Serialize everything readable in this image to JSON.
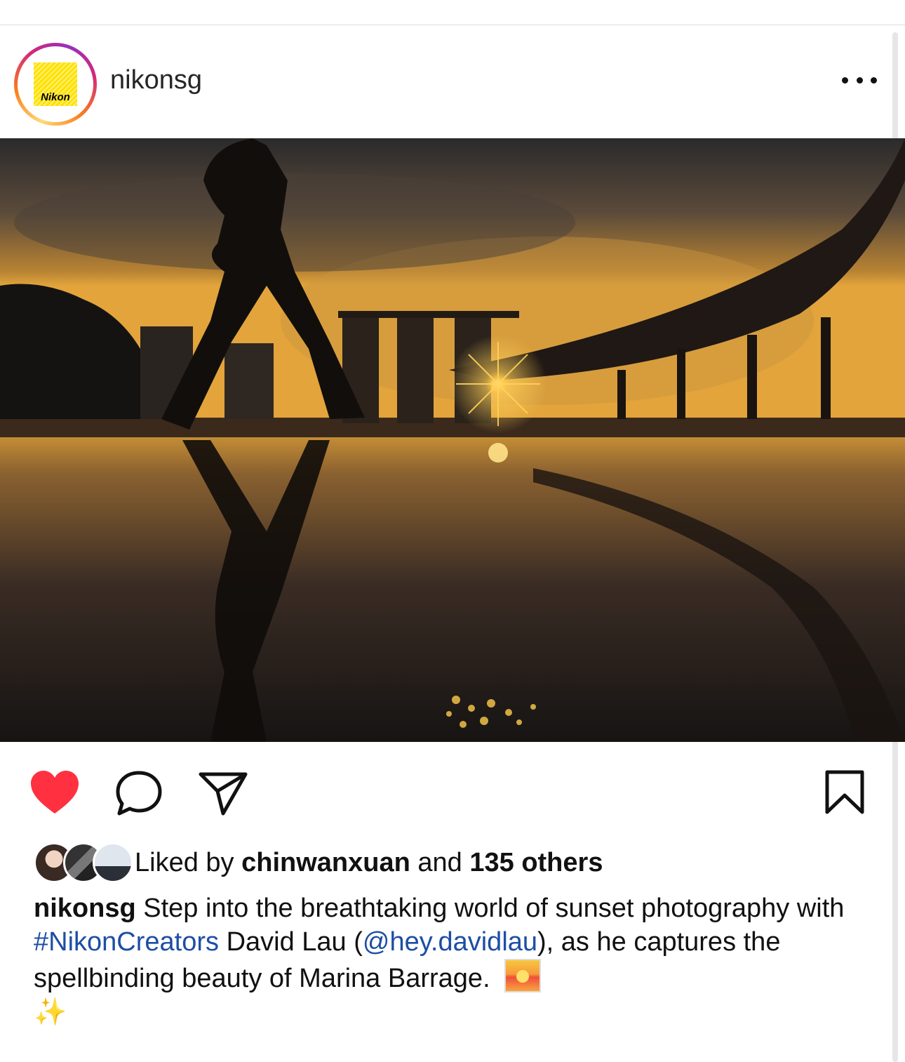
{
  "post": {
    "username": "nikonsg",
    "avatar_logo_text": "Nikon",
    "image_alt": "Silhouette walking past a puddle reflecting the sunset over Marina Bay Sands at Marina Barrage",
    "liked": true
  },
  "likes": {
    "prefix": "Liked by",
    "user": "chinwanxuan",
    "middle": "and",
    "others": "135 others"
  },
  "caption": {
    "username": "nikonsg",
    "text1": "Step into the breathtaking world of sunset photography with",
    "hashtag": "#NikonCreators",
    "text2": "David Lau (",
    "mention": "@hey.davidlau",
    "text3": "), as he captures the spellbinding beauty of Marina Barrage.",
    "sparkles": "✨"
  },
  "icons": {
    "more": "more-options-icon",
    "like": "heart-icon",
    "comment": "comment-icon",
    "share": "send-icon",
    "save": "bookmark-icon"
  },
  "colors": {
    "like_red": "#ff3040",
    "link_blue": "#1d4ea5"
  }
}
